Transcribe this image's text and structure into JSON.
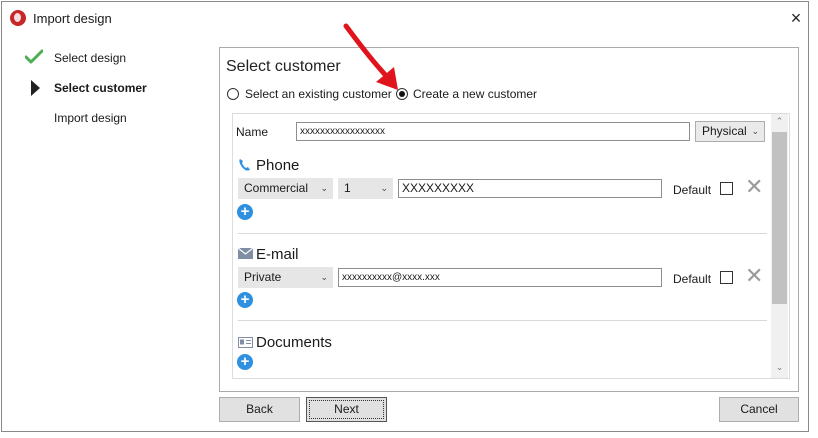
{
  "window": {
    "title": "Import design",
    "close_label": "×"
  },
  "steps": [
    {
      "label": "Select design",
      "state": "done",
      "icon": "checkmark-icon"
    },
    {
      "label": "Select customer",
      "state": "current",
      "icon": "play-arrow-icon"
    },
    {
      "label": "Import design",
      "state": "pending"
    }
  ],
  "panel": {
    "title": "Select customer",
    "radio_existing_label": "Select an existing customer",
    "radio_new_label": "Create a new customer",
    "selected": "new"
  },
  "form": {
    "name_label": "Name",
    "name_value": "xxxxxxxxxxxxxxxxx",
    "name_type": "Physical",
    "phone": {
      "title": "Phone",
      "icon": "phone-icon",
      "type": "Commercial",
      "number_index": "1",
      "value": "XXXXXXXXX",
      "default_label": "Default",
      "default_checked": false
    },
    "email": {
      "title": "E-mail",
      "icon": "envelope-icon",
      "type": "Private",
      "value": "xxxxxxxxxx@xxxx.xxx",
      "default_label": "Default",
      "default_checked": false
    },
    "documents": {
      "title": "Documents",
      "icon": "id-card-icon"
    }
  },
  "buttons": {
    "back": "Back",
    "next": "Next",
    "cancel": "Cancel"
  },
  "colors": {
    "accent_plus": "#2f8fe0",
    "check": "#4caf50",
    "annotation_arrow": "#e0141c",
    "app_icon": "#c62828"
  }
}
